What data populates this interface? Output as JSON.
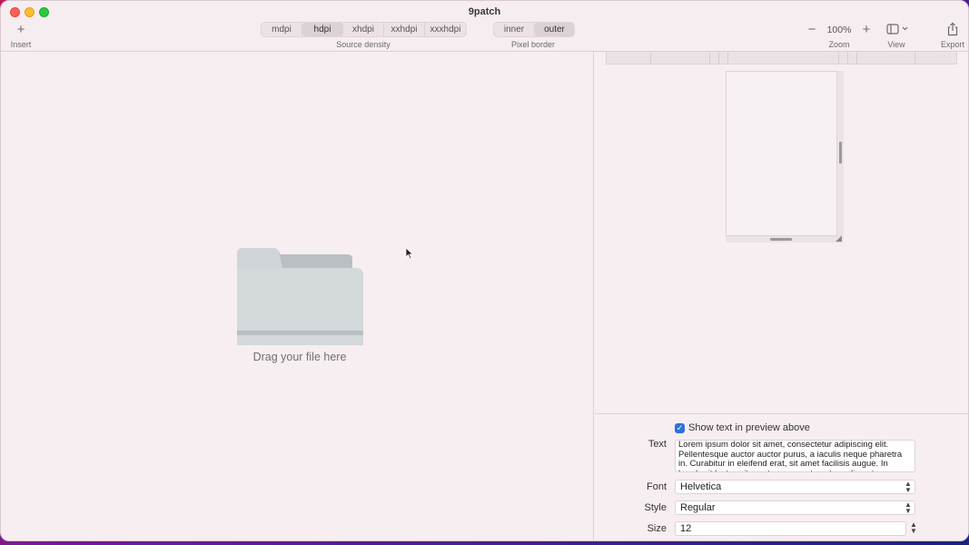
{
  "window": {
    "title": "9patch"
  },
  "toolbar": {
    "insert_label": "Insert",
    "source_density": {
      "label": "Source density",
      "options": [
        "mdpi",
        "hdpi",
        "xhdpi",
        "xxhdpi",
        "xxxhdpi"
      ],
      "selected": "hdpi"
    },
    "pixel_border": {
      "label": "Pixel border",
      "options": [
        "inner",
        "outer"
      ],
      "selected": "outer"
    },
    "zoom": {
      "label": "Zoom",
      "value": "100%"
    },
    "view_label": "View",
    "export_label": "Export"
  },
  "drop_zone": {
    "label": "Drag your file here"
  },
  "settings": {
    "show_text_label": "Show text in preview above",
    "show_text_checked": true,
    "text_label": "Text",
    "text_value": "Lorem ipsum dolor sit amet, consectetur adipiscing elit. Pellentesque auctor auctor purus, a iaculis neque pharetra in. Curabitur in eleifend erat, sit amet facilisis augue. In hendrerit lectus sit amet purus auctor, at condimentum arcu consectetur.",
    "font_label": "Font",
    "font_value": "Helvetica",
    "style_label": "Style",
    "style_value": "Regular",
    "size_label": "Size",
    "size_value": "12"
  },
  "icons": {
    "insert": "plus-icon",
    "zoom_out": "minus-icon",
    "zoom_in": "plus-icon",
    "view": "sidebar-icon",
    "export": "share-icon",
    "drop": "folder-icon"
  },
  "colors": {
    "accent": "#2a73d9",
    "close": "#ff5f57",
    "minimize": "#febc2e",
    "maximize": "#28c840"
  }
}
